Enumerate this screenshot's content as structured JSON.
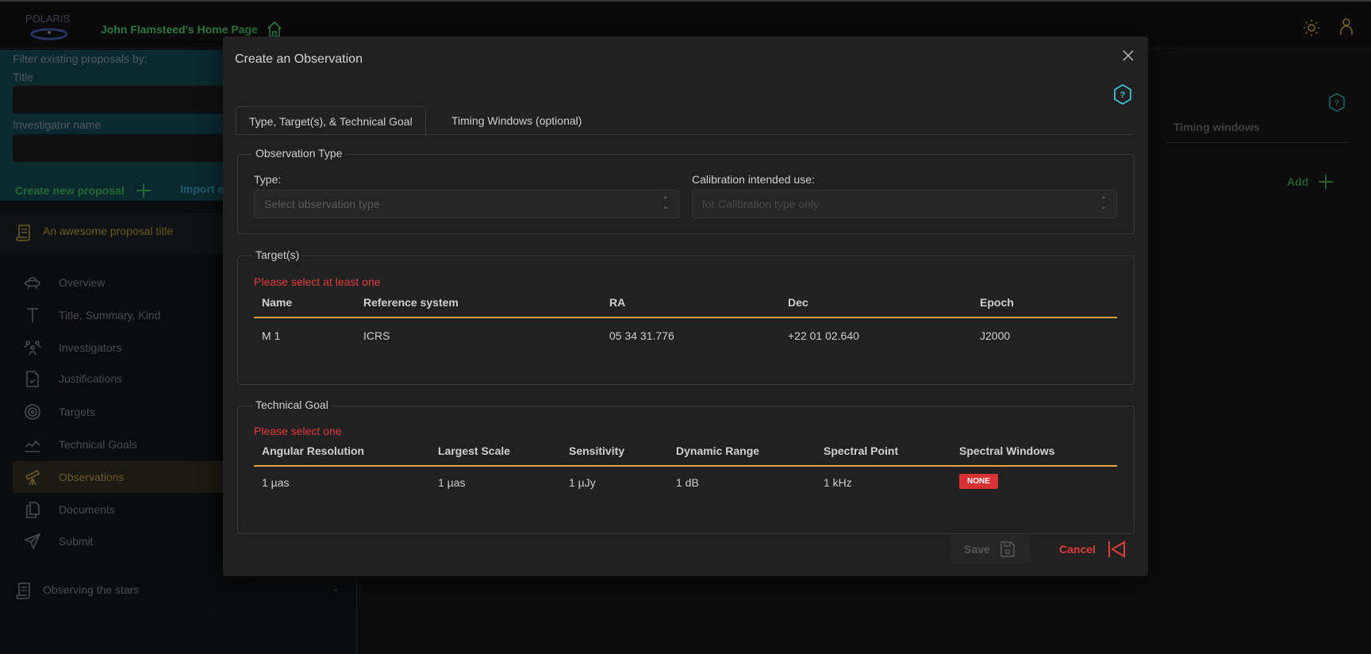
{
  "header": {
    "logo_text": "POLARIS",
    "home_link": "John Flamsteed's Home Page",
    "icons": [
      "home-icon",
      "sun-icon",
      "user-icon"
    ]
  },
  "sidebar": {
    "filter": {
      "heading": "Filter existing proposals by:",
      "title_label": "Title",
      "title_value": "",
      "investigator_label": "Investigator name",
      "investigator_value": ""
    },
    "create_new": "Create new proposal",
    "import": "Import e",
    "proposal_title": "An awesome proposal title",
    "nav": [
      {
        "label": "Overview",
        "icon": "ufo-icon"
      },
      {
        "label": "Title, Summary, Kind",
        "icon": "letter-t-icon"
      },
      {
        "label": "Investigators",
        "icon": "users-icon"
      },
      {
        "label": "Justifications",
        "icon": "file-check-icon"
      },
      {
        "label": "Targets",
        "icon": "target-icon"
      },
      {
        "label": "Technical Goals",
        "icon": "chart-line-icon"
      },
      {
        "label": "Observations",
        "icon": "telescope-icon",
        "active": true
      },
      {
        "label": "Documents",
        "icon": "documents-icon"
      },
      {
        "label": "Submit",
        "icon": "send-icon"
      }
    ],
    "other_proposal": "Observing the stars"
  },
  "main": {
    "timing_windows_header": "Timing windows",
    "add_label": "Add"
  },
  "modal": {
    "title": "Create an Observation",
    "tabs": [
      "Type, Target(s), & Technical Goal",
      "Timing Windows (optional)"
    ],
    "observation_type": {
      "legend": "Observation Type",
      "type_label": "Type:",
      "type_placeholder": "Select observation type",
      "calib_label": "Calibration intended use:",
      "calib_placeholder": "for Calibration type only"
    },
    "targets": {
      "legend": "Target(s)",
      "error": "Please select at least one",
      "columns": [
        "Name",
        "Reference system",
        "RA",
        "Dec",
        "Epoch"
      ],
      "rows": [
        [
          "M 1",
          "ICRS",
          "05 34 31.776",
          "+22 01 02.640",
          "J2000"
        ]
      ]
    },
    "technical_goal": {
      "legend": "Technical Goal",
      "error": "Please select one",
      "columns": [
        "Angular Resolution",
        "Largest Scale",
        "Sensitivity",
        "Dynamic Range",
        "Spectral Point",
        "Spectral Windows"
      ],
      "rows": [
        [
          "1 µas",
          "1 µas",
          "1 µJy",
          "1 dB",
          "1 kHz",
          "NONE"
        ]
      ]
    },
    "save": "Save",
    "cancel": "Cancel"
  },
  "colors": {
    "accent_orange": "#e8a33d",
    "error_red": "#e03c3c",
    "badge_red": "#d93232",
    "help_cyan": "#3fc3d8"
  }
}
